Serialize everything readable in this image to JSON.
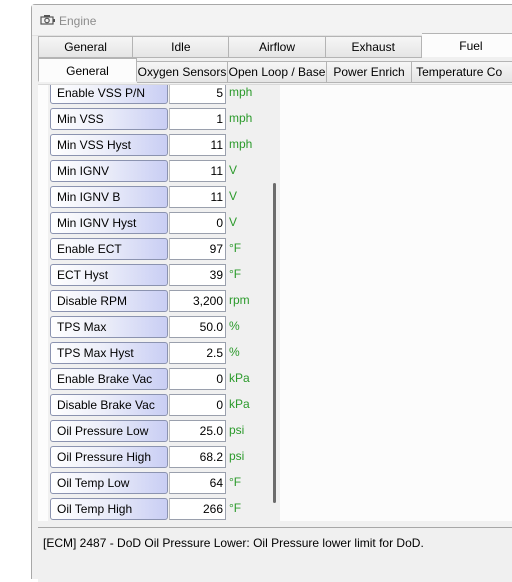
{
  "window": {
    "title": "Engine"
  },
  "main_tabs": [
    {
      "label": "General"
    },
    {
      "label": "Idle"
    },
    {
      "label": "Airflow"
    },
    {
      "label": "Exhaust"
    },
    {
      "label": "Fuel"
    }
  ],
  "sub_tabs": [
    {
      "label": "General"
    },
    {
      "label": "Oxygen Sensors"
    },
    {
      "label": "Open Loop / Base"
    },
    {
      "label": "Power Enrich"
    },
    {
      "label": "Temperature Co"
    }
  ],
  "params": [
    {
      "label": "Enable VSS P/N",
      "value": "5",
      "unit": "mph"
    },
    {
      "label": "Min VSS",
      "value": "1",
      "unit": "mph"
    },
    {
      "label": "Min VSS Hyst",
      "value": "11",
      "unit": "mph"
    },
    {
      "label": "Min IGNV",
      "value": "11",
      "unit": "V"
    },
    {
      "label": "Min IGNV B",
      "value": "11",
      "unit": "V"
    },
    {
      "label": "Min IGNV Hyst",
      "value": "0",
      "unit": "V"
    },
    {
      "label": "Enable ECT",
      "value": "97",
      "unit": "°F"
    },
    {
      "label": "ECT Hyst",
      "value": "39",
      "unit": "°F"
    },
    {
      "label": "Disable RPM",
      "value": "3,200",
      "unit": "rpm"
    },
    {
      "label": "TPS Max",
      "value": "50.0",
      "unit": "%"
    },
    {
      "label": "TPS Max Hyst",
      "value": "2.5",
      "unit": "%"
    },
    {
      "label": "Enable Brake Vac",
      "value": "0",
      "unit": "kPa"
    },
    {
      "label": "Disable Brake Vac",
      "value": "0",
      "unit": "kPa"
    },
    {
      "label": "Oil Pressure Low",
      "value": "25.0",
      "unit": "psi"
    },
    {
      "label": "Oil Pressure High",
      "value": "68.2",
      "unit": "psi"
    },
    {
      "label": "Oil Temp Low",
      "value": "64",
      "unit": "°F"
    },
    {
      "label": "Oil Temp High",
      "value": "266",
      "unit": "°F"
    }
  ],
  "status": {
    "text": "[ECM] 2487 - DoD Oil Pressure Lower: Oil Pressure lower limit for DoD."
  },
  "colors": {
    "unit": "#2b9a2b",
    "label_gradient_end": "#c9cef4",
    "title_text": "#8c8c8c"
  },
  "icons": {
    "window": "engine-icon"
  }
}
